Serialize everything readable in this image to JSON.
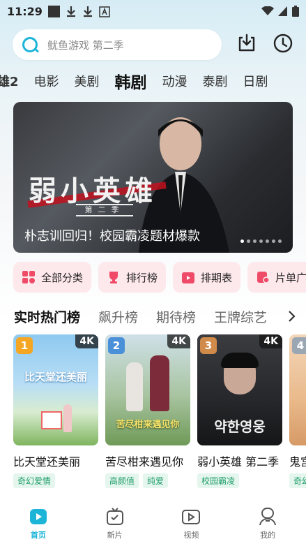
{
  "status_bar": {
    "time": "11:29"
  },
  "search": {
    "placeholder": "鱿鱼游戏 第二季"
  },
  "categories": [
    {
      "label": "雄2"
    },
    {
      "label": "电影"
    },
    {
      "label": "美剧"
    },
    {
      "label": "韩剧"
    },
    {
      "label": "动漫"
    },
    {
      "label": "泰剧"
    },
    {
      "label": "日剧"
    }
  ],
  "active_category": "韩剧",
  "banner": {
    "caption": "朴志训回归！校园霸凌题材爆款",
    "art_title": "弱小英雄",
    "art_subtitle": "第二季",
    "slide_count": 7,
    "active_slide": 1
  },
  "quick_links": [
    {
      "label": "全部分类",
      "icon": "grid-icon"
    },
    {
      "label": "排行榜",
      "icon": "trophy-icon"
    },
    {
      "label": "排期表",
      "icon": "calendar-icon"
    },
    {
      "label": "片单广",
      "icon": "playlist-icon"
    }
  ],
  "rank_tabs": [
    {
      "label": "实时热门榜"
    },
    {
      "label": "飙升榜"
    },
    {
      "label": "期待榜"
    },
    {
      "label": "王牌综艺"
    }
  ],
  "cards": [
    {
      "rank": "1",
      "badge": "4K",
      "title": "比天堂还美丽",
      "tags": [
        "奇幻爱情"
      ],
      "poster_text": "比天堂还美丽",
      "rank_color": "#f5a623"
    },
    {
      "rank": "2",
      "badge": "4K",
      "title": "苦尽柑来遇见你",
      "tags": [
        "高颜值",
        "纯爱"
      ],
      "poster_text": "苦尽柑来遇见你",
      "rank_color": "#4a90d9"
    },
    {
      "rank": "3",
      "badge": "4K",
      "title": "弱小英雄 第二季",
      "tags": [
        "校园霸凌"
      ],
      "poster_text": "약한영웅",
      "rank_color": "#d08a4a"
    },
    {
      "rank": "4",
      "badge": "",
      "title": "鬼宫",
      "tags": [
        "奇幻"
      ],
      "poster_text": "",
      "rank_color": "#9aa6b2"
    }
  ],
  "bottom_nav": [
    {
      "label": "首页",
      "icon": "home-play-icon",
      "active": true
    },
    {
      "label": "新片",
      "icon": "new-tv-icon",
      "active": false
    },
    {
      "label": "视频",
      "icon": "video-camera-icon",
      "active": false
    },
    {
      "label": "我的",
      "icon": "profile-icon",
      "active": false
    }
  ],
  "colors": {
    "accent": "#1cb5d8",
    "tag_green": "#1f9d6a",
    "quick_bg": "#fde8ec",
    "quick_icon": "#ef4b68"
  }
}
